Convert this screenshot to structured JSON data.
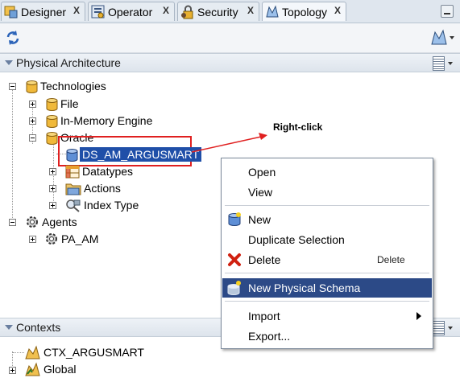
{
  "tabs": [
    {
      "label": "Designer",
      "close": "X"
    },
    {
      "label": "Operator",
      "close": "X"
    },
    {
      "label": "Security",
      "close": "X"
    },
    {
      "label": "Topology",
      "close": "X"
    }
  ],
  "physical_architecture": {
    "title": "Physical Architecture",
    "tree": {
      "technologies": "Technologies",
      "file": "File",
      "in_memory_engine": "In-Memory Engine",
      "oracle": "Oracle",
      "data_server": "DS_AM_ARGUSMART",
      "datatypes": "Datatypes",
      "actions": "Actions",
      "index_type": "Index Type",
      "agents": "Agents",
      "agent_pa_am": "PA_AM"
    }
  },
  "annotation": {
    "label": "Right-click",
    "color": "#e02020"
  },
  "context_menu": {
    "open": "Open",
    "view": "View",
    "new": "New",
    "duplicate_selection": "Duplicate Selection",
    "delete": "Delete",
    "delete_shortcut": "Delete",
    "new_physical_schema": "New Physical Schema",
    "import": "Import",
    "export": "Export..."
  },
  "contexts": {
    "title": "Contexts",
    "items": [
      "CTX_ARGUSMART",
      "Global"
    ]
  },
  "colors": {
    "selection": "#2c4a87",
    "tree_selection": "#1f4fa8",
    "highlight_box": "#e02020"
  }
}
